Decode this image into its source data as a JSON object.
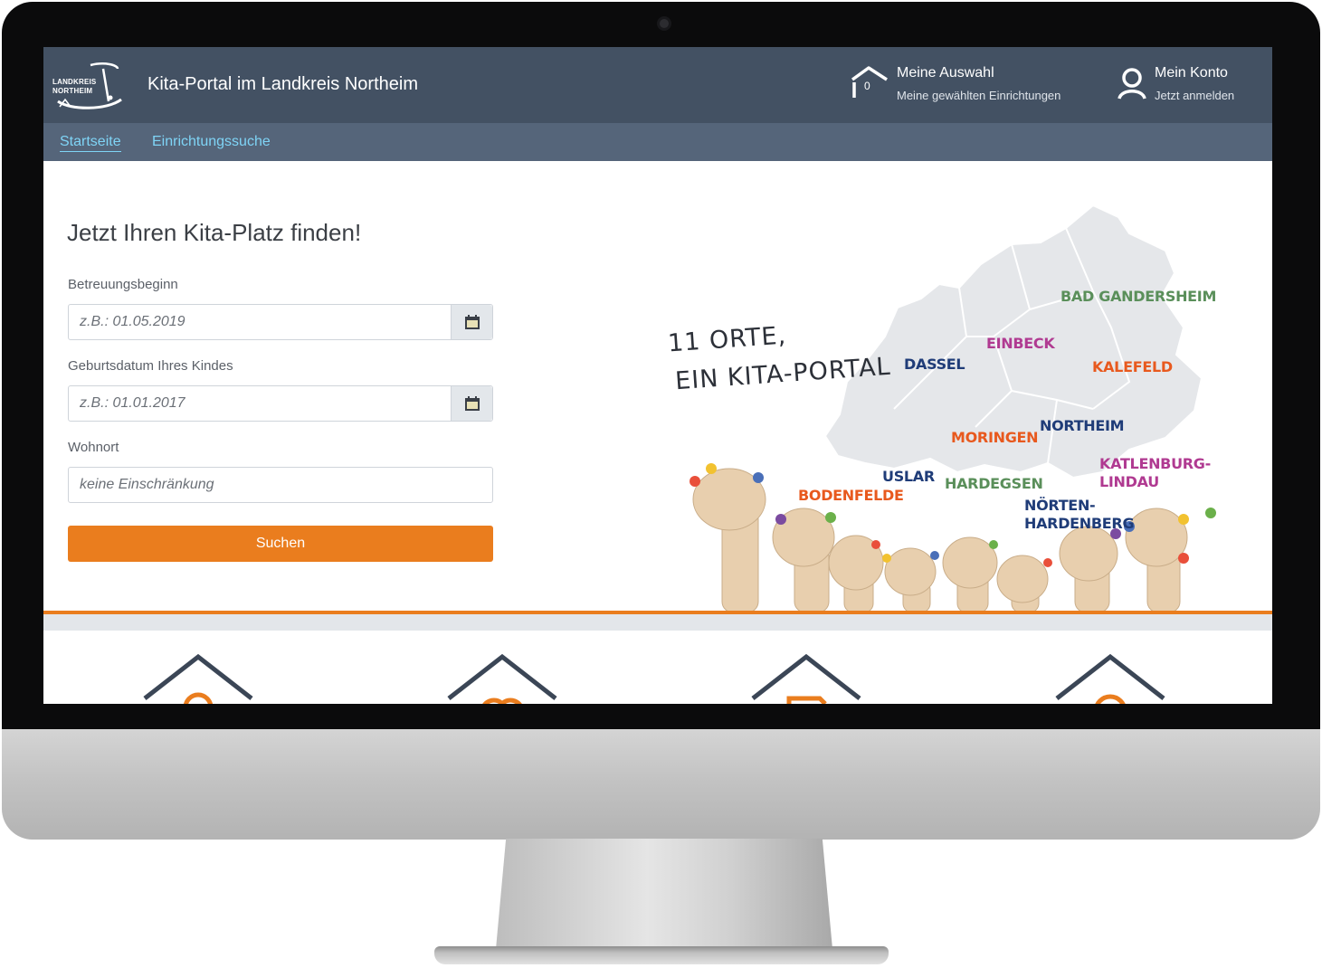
{
  "header": {
    "logo_text_line1": "LANDKREIS",
    "logo_text_line2": "NORTHEIM",
    "site_title": "Kita-Portal im Landkreis Northeim",
    "auswahl": {
      "title": "Meine Auswahl",
      "subtitle": "Meine gewählten Einrichtungen",
      "count": "0"
    },
    "konto": {
      "title": "Mein Konto",
      "subtitle": "Jetzt anmelden"
    }
  },
  "nav": {
    "items": [
      {
        "label": "Startseite",
        "active": true
      },
      {
        "label": "Einrichtungssuche",
        "active": false
      }
    ]
  },
  "search": {
    "title": "Jetzt Ihren Kita-Platz finden!",
    "betreuungsbeginn_label": "Betreuungsbeginn",
    "betreuungsbeginn_placeholder": "z.B.: 01.05.2019",
    "geburtsdatum_label": "Geburtsdatum Ihres Kindes",
    "geburtsdatum_placeholder": "z.B.: 01.01.2017",
    "wohnort_label": "Wohnort",
    "wohnort_placeholder": "keine Einschränkung",
    "submit_label": "Suchen"
  },
  "illustration": {
    "slogan_line1": "11 ORTE,",
    "slogan_line2": "EIN KITA-PORTAL",
    "towns": [
      {
        "name": "BAD GANDERSHEIM",
        "color": "#5a8f5a"
      },
      {
        "name": "EINBECK",
        "color": "#b03a91"
      },
      {
        "name": "DASSEL",
        "color": "#1f3c78"
      },
      {
        "name": "KALEFELD",
        "color": "#e8591e"
      },
      {
        "name": "NORTHEIM",
        "color": "#1f3c78"
      },
      {
        "name": "MORINGEN",
        "color": "#e8591e"
      },
      {
        "name": "KATLENBURG-",
        "color": "#b03a91"
      },
      {
        "name": "LINDAU",
        "color": "#b03a91"
      },
      {
        "name": "USLAR",
        "color": "#1f3c78"
      },
      {
        "name": "HARDEGSEN",
        "color": "#5a8f5a"
      },
      {
        "name": "BODENFELDE",
        "color": "#e8591e"
      },
      {
        "name": "NÖRTEN-",
        "color": "#1f3c78"
      },
      {
        "name": "HARDENBERG",
        "color": "#1f3c78"
      }
    ]
  },
  "colors": {
    "header_bg": "#435163",
    "subnav_bg": "#55657a",
    "link": "#7fd4f6",
    "accent": "#ea7d1e"
  }
}
